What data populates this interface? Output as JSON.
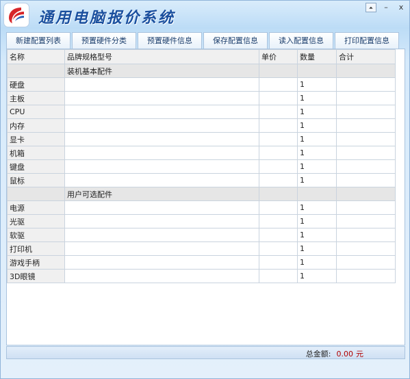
{
  "app": {
    "title": "通用电脑报价系统"
  },
  "window_controls": {
    "pin": "⏶",
    "minimize": "–",
    "close": "x"
  },
  "toolbar": [
    "新建配置列表",
    "预置硬件分类",
    "预置硬件信息",
    "保存配置信息",
    "读入配置信息",
    "打印配置信息"
  ],
  "table": {
    "headers": [
      "名称",
      "品牌规格型号",
      "单价",
      "数量",
      "合计"
    ],
    "rows": [
      {
        "type": "group",
        "name": "",
        "spec": "装机基本配件",
        "price": "",
        "qty": "",
        "total": ""
      },
      {
        "type": "item",
        "name": "硬盘",
        "spec": "",
        "price": "",
        "qty": "1",
        "total": ""
      },
      {
        "type": "item",
        "name": "主板",
        "spec": "",
        "price": "",
        "qty": "1",
        "total": ""
      },
      {
        "type": "item",
        "name": "CPU",
        "spec": "",
        "price": "",
        "qty": "1",
        "total": ""
      },
      {
        "type": "item",
        "name": "内存",
        "spec": "",
        "price": "",
        "qty": "1",
        "total": ""
      },
      {
        "type": "item",
        "name": "显卡",
        "spec": "",
        "price": "",
        "qty": "1",
        "total": ""
      },
      {
        "type": "item",
        "name": "机箱",
        "spec": "",
        "price": "",
        "qty": "1",
        "total": ""
      },
      {
        "type": "item",
        "name": "键盘",
        "spec": "",
        "price": "",
        "qty": "1",
        "total": ""
      },
      {
        "type": "item",
        "name": "鼠标",
        "spec": "",
        "price": "",
        "qty": "1",
        "total": ""
      },
      {
        "type": "group",
        "name": "",
        "spec": "用户可选配件",
        "price": "",
        "qty": "",
        "total": ""
      },
      {
        "type": "item",
        "name": "电源",
        "spec": "",
        "price": "",
        "qty": "1",
        "total": ""
      },
      {
        "type": "item",
        "name": "光驱",
        "spec": "",
        "price": "",
        "qty": "1",
        "total": ""
      },
      {
        "type": "item",
        "name": "软驱",
        "spec": "",
        "price": "",
        "qty": "1",
        "total": ""
      },
      {
        "type": "item",
        "name": "打印机",
        "spec": "",
        "price": "",
        "qty": "1",
        "total": ""
      },
      {
        "type": "item",
        "name": "游戏手柄",
        "spec": "",
        "price": "",
        "qty": "1",
        "total": ""
      },
      {
        "type": "item",
        "name": "3D眼镜",
        "spec": "",
        "price": "",
        "qty": "1",
        "total": ""
      }
    ]
  },
  "footer": {
    "total_label": "总金额:",
    "total_value": "0.00",
    "currency": "元"
  },
  "colors": {
    "accent": "#1a4f9e",
    "amount": "#b00000",
    "frame": "#bcdcf6"
  },
  "icons": {
    "logo": "app-logo-icon"
  }
}
